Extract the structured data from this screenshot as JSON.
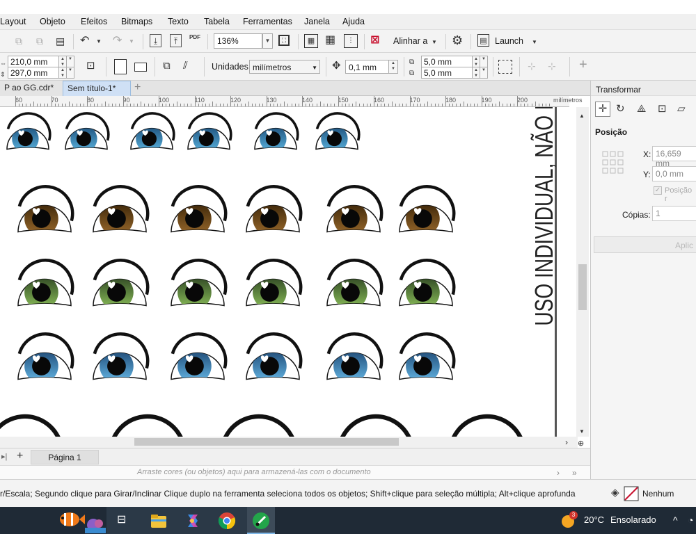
{
  "menubar": {
    "items": [
      "Layout",
      "Objeto",
      "Efeitos",
      "Bitmaps",
      "Texto",
      "Tabela",
      "Ferramentas",
      "Janela",
      "Ajuda"
    ]
  },
  "toolbar": {
    "zoom": "136%",
    "align_label": "Alinhar a",
    "launch_label": "Launch",
    "pdf_label": "PDF"
  },
  "property_bar": {
    "width": "210,0 mm",
    "height": "297,0 mm",
    "units_label": "Unidades:",
    "units_value": "milímetros",
    "nudge": "0,1 mm",
    "dup_x": "5,0 mm",
    "dup_y": "5,0 mm"
  },
  "tabs": [
    {
      "label": "P ao GG.cdr*"
    },
    {
      "label": "Sem título-1*"
    }
  ],
  "ruler": {
    "labels": [
      "60",
      "70",
      "80",
      "90",
      "100",
      "110",
      "120",
      "130",
      "140",
      "150",
      "160",
      "170",
      "180",
      "190",
      "200"
    ],
    "unit": "milímetros"
  },
  "canvas": {
    "watermark_text": "USO INDIVIDUAL, NÃO PO",
    "eye_rows": [
      {
        "color": "#5bb4e0",
        "dark": "#1d4f7a",
        "count": 6
      },
      {
        "color": "#9a6a2c",
        "dark": "#3a2408",
        "count": 6
      },
      {
        "color": "#8cc05a",
        "dark": "#2d4422",
        "count": 6
      },
      {
        "color": "#66b9e8",
        "dark": "#1d4772",
        "count": 6
      },
      {
        "color": "#a3712e",
        "dark": "#2a1a06",
        "count": 5
      }
    ]
  },
  "page_bar": {
    "page_label": "Página 1",
    "palette_hint": "Arraste cores (ou objetos) aqui para armazená-las com o documento"
  },
  "status": {
    "hint": "r/Escala; Segundo clique para Girar/Inclinar Clique duplo na ferramenta seleciona todos os objetos; Shift+clique para seleção múltipla; Alt+clique aprofunda",
    "fill_label": "Nenhum"
  },
  "panel": {
    "title": "Transformar",
    "section": "Posição",
    "x_label": "X:",
    "x_value": "16,659 mm",
    "y_label": "Y:",
    "y_value": "0,0 mm",
    "relative_label": "Posição r",
    "copies_label": "Cópias:",
    "copies_value": "1",
    "apply_label": "Aplic"
  },
  "taskbar": {
    "weather_badge": "3",
    "temperature": "20°C",
    "weather_text": "Ensolarado"
  }
}
